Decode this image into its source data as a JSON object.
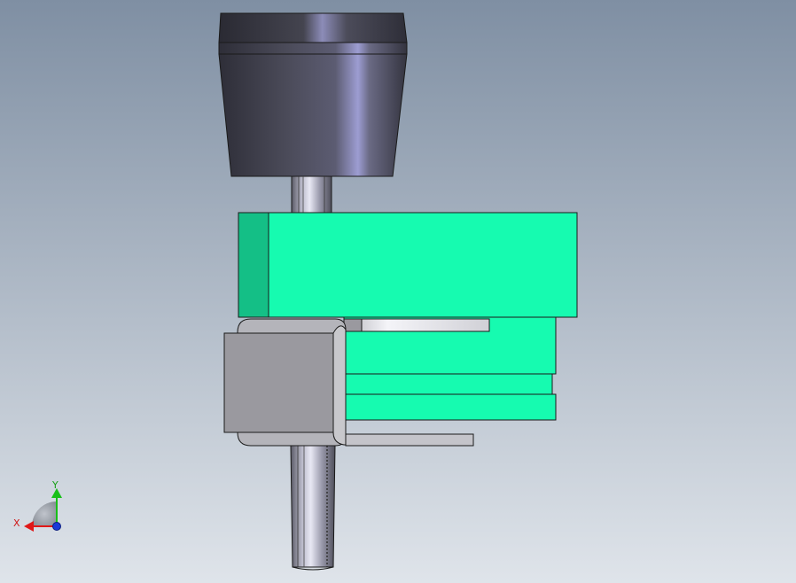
{
  "viewport": {
    "background_top": "#7f8fa3",
    "background_bottom": "#dfe4ea"
  },
  "colors": {
    "green_face": "#16fbb0",
    "green_shadow": "#14bf86",
    "gray_body": "#9a999f",
    "gray_light": "#c8c8cc",
    "knob_dark": "#3d3d48",
    "outline": "#1a1a1a"
  },
  "triad": {
    "x_label": "X",
    "y_label": "Y",
    "x_color": "#e01818",
    "y_color": "#18c018",
    "z_color": "#1a3ad8"
  }
}
